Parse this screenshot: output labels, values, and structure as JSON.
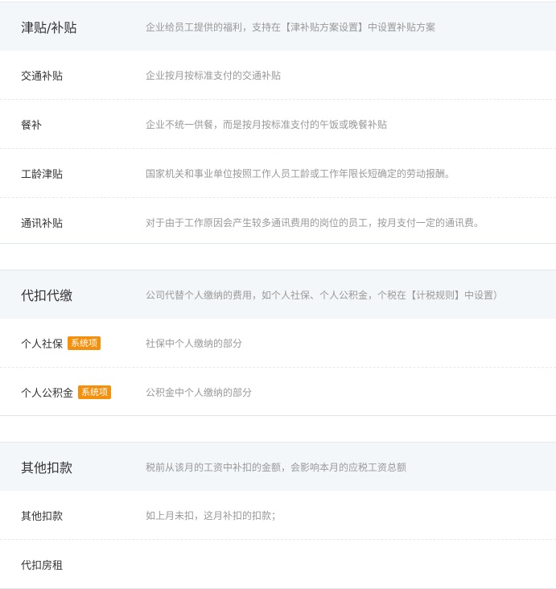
{
  "sections": [
    {
      "title": "津贴/补贴",
      "description": "企业给员工提供的福利，支持在【津补贴方案设置】中设置补贴方案",
      "rows": [
        {
          "name": "交通补贴",
          "description": "企业按月按标准支付的交通补贴"
        },
        {
          "name": "餐补",
          "description": "企业不统一供餐，而是按月按标准支付的午饭或晚餐补贴"
        },
        {
          "name": "工龄津贴",
          "description": "国家机关和事业单位按照工作人员工龄或工作年限长短确定的劳动报酬。"
        },
        {
          "name": "通讯补贴",
          "description": "对于由于工作原因会产生较多通讯费用的岗位的员工，按月支付一定的通讯费。"
        }
      ]
    },
    {
      "title": "代扣代缴",
      "description": "公司代替个人缴纳的费用，如个人社保、个人公积金，个税在【计税规则】中设置）",
      "rows": [
        {
          "name": "个人社保",
          "badge": "系统项",
          "description": "社保中个人缴纳的部分"
        },
        {
          "name": "个人公积金",
          "badge": "系统项",
          "description": "公积金中个人缴纳的部分"
        }
      ]
    },
    {
      "title": "其他扣款",
      "description": "税前从该月的工资中补扣的金额，会影响本月的应税工资总额",
      "rows": [
        {
          "name": "其他扣款",
          "description": "如上月未扣，这月补扣的扣款；"
        },
        {
          "name": "代扣房租",
          "description": ""
        }
      ]
    }
  ],
  "colors": {
    "badge": "#f5900d",
    "header_bg": "#f4f7fa",
    "title_text": "#333333",
    "desc_text": "#999999"
  }
}
